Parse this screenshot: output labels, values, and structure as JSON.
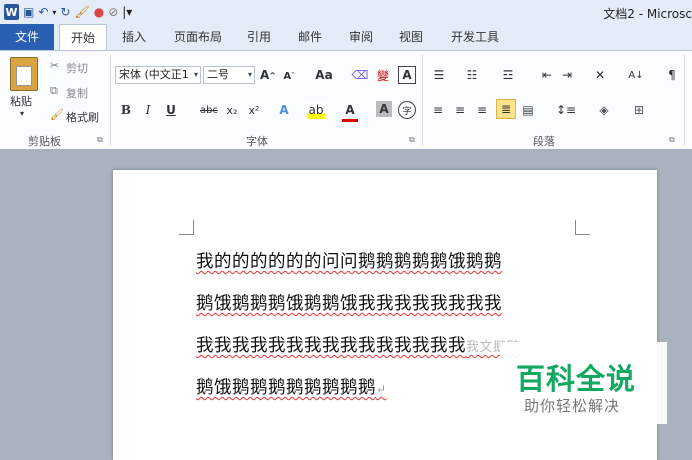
{
  "window": {
    "title": "文档2 - Microsc"
  },
  "quick_access": {
    "customize_glyph": "|▾"
  },
  "tabs": [
    "文件",
    "开始",
    "插入",
    "页面布局",
    "引用",
    "邮件",
    "审阅",
    "视图",
    "开发工具"
  ],
  "ribbon": {
    "clipboard": {
      "paste_label": "粘贴",
      "cut_label": "剪切",
      "copy_label": "复制",
      "format_painter_label": "格式刷",
      "group_label": "剪贴板"
    },
    "font": {
      "font_name": "宋体 (中文正1",
      "font_size": "二号",
      "grow_label": "A",
      "shrink_label": "A",
      "case_label": "Aa",
      "phonetic_label": "變",
      "border_char_label": "A",
      "bold": "B",
      "italic": "I",
      "underline": "U",
      "strike": "abc",
      "subscript": "x₂",
      "superscript": "x²",
      "group_label": "字体"
    },
    "paragraph": {
      "group_label": "段落"
    }
  },
  "document": {
    "lines": [
      "我的的的的的的问问鹅鹅鹅鹅鹅饿鹅鹅",
      "鹅饿鹅鹅鹅饿鹅鹅饿我我我我我我我我",
      "我我我我我我我我我我我我我我我",
      "鹅饿鹅鹅鹅鹅鹅鹅鹅鹅"
    ],
    "line4_overlap_text": "我文鹅鹅",
    "paragraph_mark": "↵"
  },
  "watermark": {
    "main": "百科全说",
    "sub": "助你轻松解决"
  },
  "colors": {
    "file_tab": "#2b5fb3",
    "accent_blue": "#2b579a",
    "watermark_green": "#13a860",
    "squiggle_red": "#e33333"
  }
}
